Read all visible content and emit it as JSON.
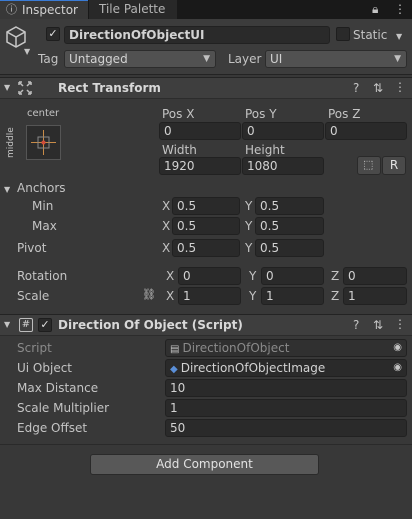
{
  "tabs": [
    {
      "label": "Inspector"
    },
    {
      "label": "Tile Palette"
    }
  ],
  "object": {
    "name": "DirectionOfObjectUI",
    "static_label": "Static",
    "tag_label": "Tag",
    "tag_value": "Untagged",
    "layer_label": "Layer",
    "layer_value": "UI"
  },
  "rect_transform": {
    "title": "Rect Transform",
    "anchor_preset_h": "center",
    "anchor_preset_v": "middle",
    "pos_x_label": "Pos X",
    "pos_y_label": "Pos Y",
    "pos_z_label": "Pos Z",
    "pos_x": "0",
    "pos_y": "0",
    "pos_z": "0",
    "width_label": "Width",
    "height_label": "Height",
    "width": "1920",
    "height": "1080",
    "raw_button": "R",
    "anchors_label": "Anchors",
    "min_label": "Min",
    "max_label": "Max",
    "min_x": "0.5",
    "min_y": "0.5",
    "max_x": "0.5",
    "max_y": "0.5",
    "pivot_label": "Pivot",
    "pivot_x": "0.5",
    "pivot_y": "0.5",
    "rotation_label": "Rotation",
    "rot_x": "0",
    "rot_y": "0",
    "rot_z": "0",
    "scale_label": "Scale",
    "scale_x": "1",
    "scale_y": "1",
    "scale_z": "1",
    "x": "X",
    "y": "Y",
    "z": "Z"
  },
  "script_component": {
    "title": "Direction Of Object (Script)",
    "script_label": "Script",
    "script_value": "DirectionOfObject",
    "ui_object_label": "Ui Object",
    "ui_object_value": "DirectionOfObjectImage",
    "max_distance_label": "Max Distance",
    "max_distance_value": "10",
    "scale_multiplier_label": "Scale Multiplier",
    "scale_multiplier_value": "1",
    "edge_offset_label": "Edge Offset",
    "edge_offset_value": "50"
  },
  "add_component_label": "Add Component",
  "colors": {
    "accent": "#3a7bd5",
    "background": "#383838",
    "field": "#2a2a2a"
  }
}
